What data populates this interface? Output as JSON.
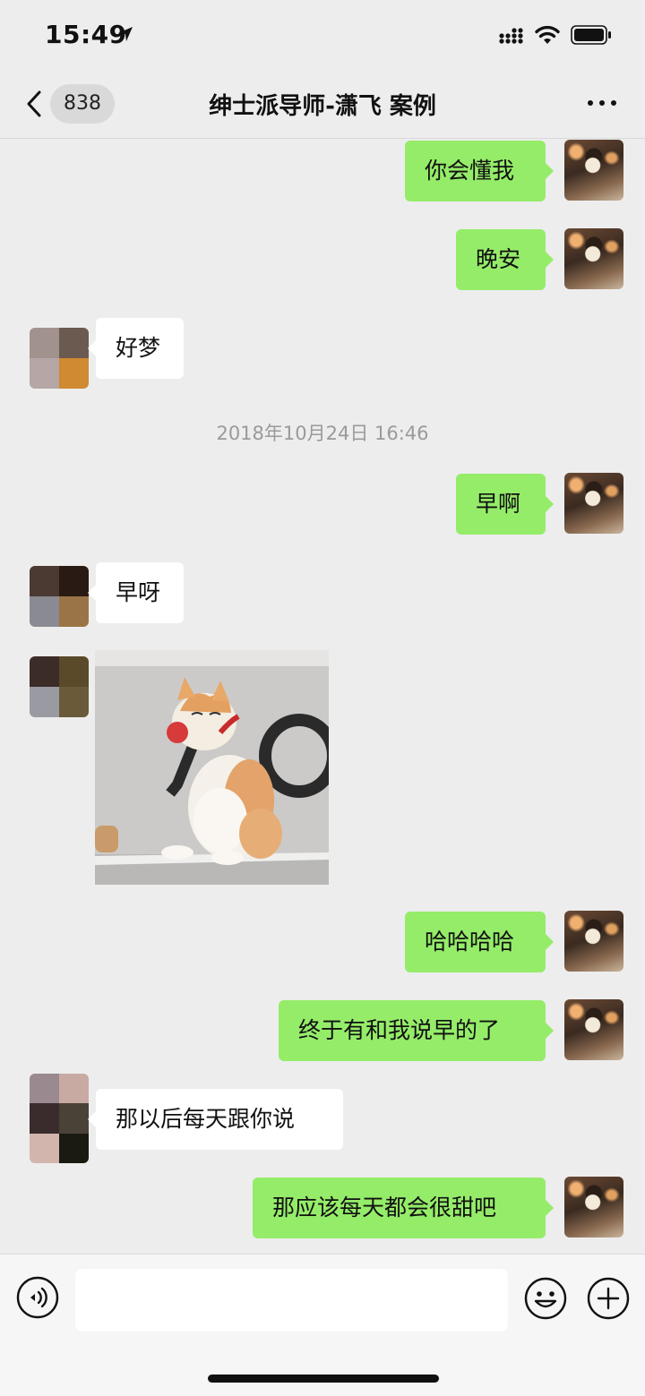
{
  "status_bar": {
    "time": "15:49"
  },
  "nav": {
    "unread_count": "838",
    "title": "绅士派导师-潇飞 案例"
  },
  "messages": [
    {
      "from": "me",
      "text": "你会懂我"
    },
    {
      "from": "me",
      "text": "晚安"
    },
    {
      "from": "other",
      "text": "好梦"
    },
    {
      "type": "timestamp",
      "text": "2018年10月24日 16:46"
    },
    {
      "from": "me",
      "text": "早啊"
    },
    {
      "from": "other",
      "text": "早呀"
    },
    {
      "from": "other",
      "type": "image",
      "image": "cat-sticker"
    },
    {
      "from": "me",
      "text": "哈哈哈哈"
    },
    {
      "from": "me",
      "text": "终于有和我说早的了"
    },
    {
      "from": "other",
      "text": "那以后每天跟你说"
    },
    {
      "from": "me",
      "text": "那应该每天都会很甜吧"
    }
  ],
  "icons": [
    "location-arrow-icon",
    "signal-icon",
    "wifi-icon",
    "battery-icon",
    "back-icon",
    "more-icon",
    "voice-icon",
    "emoji-icon",
    "plus-icon"
  ],
  "colors": {
    "my_bubble": "#95ec69",
    "their_bubble": "#ffffff",
    "background": "#ededed"
  }
}
